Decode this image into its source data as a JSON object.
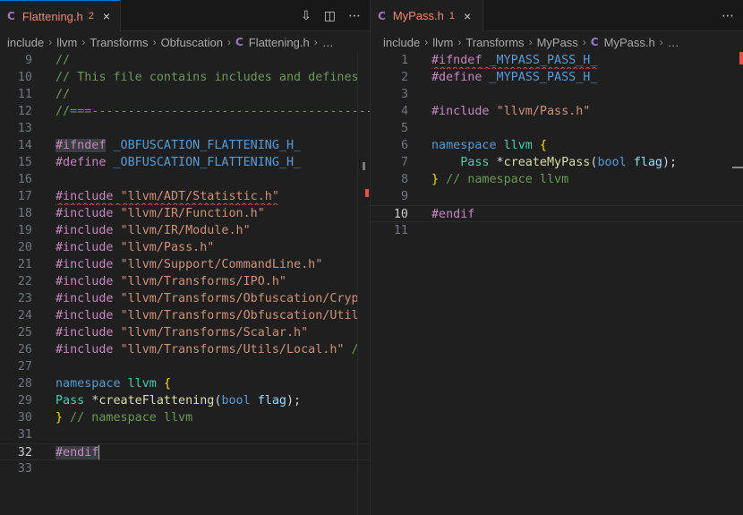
{
  "left": {
    "tab": {
      "icon": "C",
      "name": "Flattening.h",
      "count": "2",
      "close": "×"
    },
    "breadcrumb": [
      "include",
      "llvm",
      "Transforms",
      "Obfuscation"
    ],
    "breadcrumb_file_icon": "C",
    "breadcrumb_file": "Flattening.h",
    "breadcrumb_more": "…",
    "actions": {
      "diff_icon": "⇩",
      "split_icon": "◫",
      "more_icon": "⋯"
    },
    "lines": {
      "n9": "9",
      "n10": "10",
      "n11": "11",
      "n12": "12",
      "n13": "13",
      "n14": "14",
      "n15": "15",
      "n16": "16",
      "n17": "17",
      "n18": "18",
      "n19": "19",
      "n20": "20",
      "n21": "21",
      "n22": "22",
      "n23": "23",
      "n24": "24",
      "n25": "25",
      "n26": "26",
      "n27": "27",
      "n28": "28",
      "n29": "29",
      "n30": "30",
      "n31": "31",
      "n32": "32",
      "n33": "33",
      "c9": "//",
      "c10": "// This file contains includes and defines",
      "c11": "//",
      "c12": "//===-------------------------------------------",
      "c14_dir": "#ifndef",
      "c14_macro": "_OBFUSCATION_FLATTENING_H_",
      "c15_dir": "#define",
      "c15_macro": "_OBFUSCATION_FLATTENING_H_",
      "inc": "#include",
      "s17": "\"llvm/ADT/Statistic.h\"",
      "s18": "\"llvm/IR/Function.h\"",
      "s19": "\"llvm/IR/Module.h\"",
      "s20": "\"llvm/Pass.h\"",
      "s21": "\"llvm/Support/CommandLine.h\"",
      "s22": "\"llvm/Transforms/IPO.h\"",
      "s23": "\"llvm/Transforms/Obfuscation/Cryp",
      "s24": "\"llvm/Transforms/Obfuscation/Util",
      "s25": "\"llvm/Transforms/Scalar.h\"",
      "s26": "\"llvm/Transforms/Utils/Local.h\"",
      "s26_tail": " /",
      "kw_namespace": "namespace",
      "ns_llvm": "llvm",
      "brace_open": "{",
      "brace_close": "}",
      "t_pass": "Pass",
      "star": " *",
      "fn29": "createFlattening",
      "paren_open": "(",
      "kw_bool": "bool",
      "param_flag": "flag",
      "paren_close": ");",
      "end_comment": "// namespace llvm",
      "endif": "#endif"
    }
  },
  "right": {
    "tab": {
      "icon": "C",
      "name": "MyPass.h",
      "count": "1",
      "close": "×"
    },
    "breadcrumb": [
      "include",
      "llvm",
      "Transforms",
      "MyPass"
    ],
    "breadcrumb_file_icon": "C",
    "breadcrumb_file": "MyPass.h",
    "breadcrumb_more": "…",
    "actions": {
      "more_icon": "⋯"
    },
    "lines": {
      "n1": "1",
      "n2": "2",
      "n3": "3",
      "n4": "4",
      "n5": "5",
      "n6": "6",
      "n7": "7",
      "n8": "8",
      "n9": "9",
      "n10": "10",
      "n11": "11",
      "c1_dir": "#ifndef",
      "c1_macro": "_MYPASS_PASS_H_",
      "c2_dir": "#define",
      "c2_macro": "_MYPASS_PASS_H_",
      "c4_dir": "#include",
      "c4_str": "\"llvm/Pass.h\"",
      "kw_namespace": "namespace",
      "ns_llvm": "llvm",
      "brace_open": "{",
      "brace_close": "}",
      "t_pass": "Pass",
      "star": " *",
      "fn7": "createMyPass",
      "paren_open": "(",
      "kw_bool": "bool",
      "param_flag": "flag",
      "paren_close": ");",
      "end_comment": "// namespace llvm",
      "endif": "#endif"
    }
  },
  "colors": {
    "background": "#1f1f1f",
    "comment": "#6a9955",
    "directive": "#c586c0",
    "string": "#ce9178",
    "keyword": "#569cd6",
    "type": "#4ec9b0",
    "function": "#dcdcaa",
    "error": "#f14c4c",
    "tab_error": "#f48771"
  }
}
